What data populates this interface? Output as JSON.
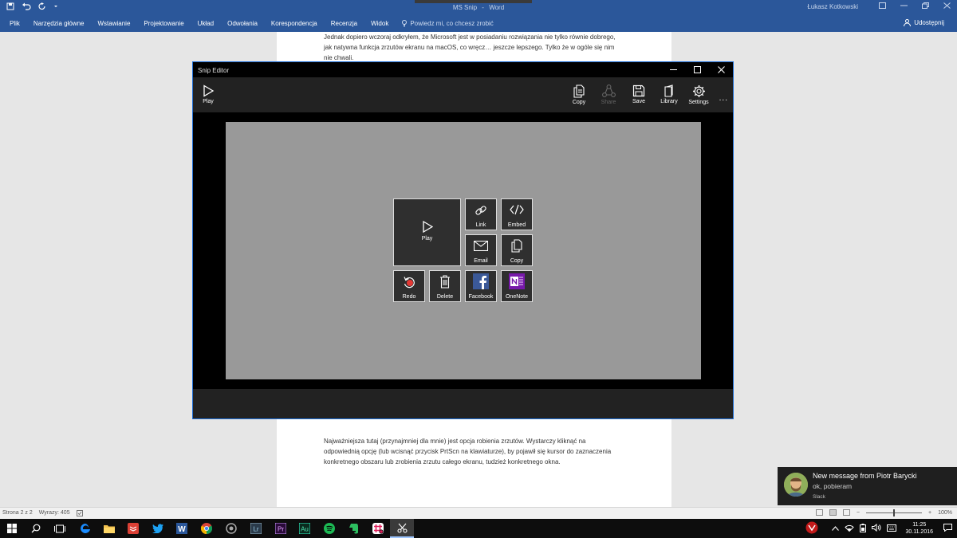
{
  "word": {
    "title": [
      "MS Snip",
      "-",
      "Word"
    ],
    "user": "Łukasz Kotkowski",
    "tabs": [
      "Plik",
      "Narzędzia główne",
      "Wstawianie",
      "Projektowanie",
      "Układ",
      "Odwołania",
      "Korespondencja",
      "Recenzja",
      "Widok"
    ],
    "tell_me": "Powiedz mi, co chcesz zrobić",
    "share": "Udostępnij"
  },
  "document": {
    "para_top": "Jednak dopiero wczoraj odkryłem, że Microsoft jest w posiadaniu rozwiązania nie tylko równie dobrego, jak natywna funkcja zrzutów ekranu na macOS, co wręcz… jeszcze lepszego. Tylko że w ogóle się nim nie chwali.",
    "para_bottom": "Najważniejsza tutaj (przynajmniej dla mnie) jest opcja robienia zrzutów. Wystarczy kliknąć na odpowiednią opcję (lub wcisnąć przycisk PrtScn na klawiaturze), by pojawił się kursor do zaznaczenia konkretnego obszaru lub zrobienia zrzutu całego ekranu, tudzież konkretnego okna."
  },
  "status": {
    "page": "Strona 2 z 2",
    "words": "Wyrazy: 405",
    "zoom": "100%"
  },
  "snip": {
    "title": "Snip Editor",
    "toolbar": {
      "play": "Play",
      "copy": "Copy",
      "share": "Share",
      "save": "Save",
      "library": "Library",
      "settings": "Settings",
      "more": "..."
    },
    "tiles": {
      "play": "Play",
      "link": "Link",
      "embed": "Embed",
      "email": "Email",
      "copy": "Copy",
      "redo": "Redo",
      "delete": "Delete",
      "facebook": "Facebook",
      "onenote": "OneNote"
    }
  },
  "toast": {
    "title": "New message from Piotr Barycki",
    "message": "ok, pobieram",
    "app": "Slack"
  },
  "clock": {
    "time": "11:25",
    "date": "30.11.2016"
  },
  "taskbar_apps": [
    "start-icon",
    "search-icon",
    "task-view-icon",
    "edge-icon",
    "file-explorer-icon",
    "todoist-icon",
    "twitter-icon",
    "word-icon",
    "chrome-icon",
    "app-icon",
    "lightroom-icon",
    "premiere-icon",
    "audition-icon",
    "spotify-icon",
    "evernote-icon",
    "slack-icon",
    "snip-icon"
  ],
  "taskbar_labels": {
    "lightroom": "Lr",
    "premiere": "Pr",
    "audition": "Au",
    "word": "W"
  },
  "colors": {
    "word_blue": "#2b579a",
    "snip_border": "#1e6fd9",
    "canvas_gray": "#999999",
    "tile_bg": "#2f2f2f",
    "facebook_blue": "#3b5998",
    "onenote_purple": "#7719aa"
  }
}
